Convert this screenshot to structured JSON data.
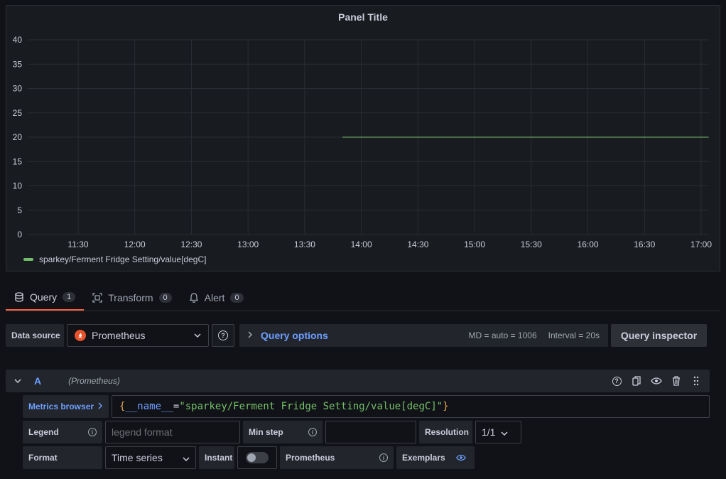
{
  "panel": {
    "title": "Panel Title"
  },
  "chart_data": {
    "type": "line",
    "title": "Panel Title",
    "y_ticks": [
      "40",
      "35",
      "30",
      "25",
      "20",
      "15",
      "10",
      "5",
      "0"
    ],
    "x_ticks": [
      "11:30",
      "12:00",
      "12:30",
      "13:00",
      "13:30",
      "14:00",
      "14:30",
      "15:00",
      "15:30",
      "16:00",
      "16:30",
      "17:00"
    ],
    "ylim": [
      0,
      40
    ],
    "grid": true,
    "legend_position": "bottom-left",
    "series": [
      {
        "name": "sparkey/Ferment Fridge Setting/value[degC]",
        "color": "#73bf69",
        "x": [
          "13:50",
          "17:04"
        ],
        "y": [
          20,
          20
        ]
      }
    ]
  },
  "tabs": [
    {
      "label": "Query",
      "count": "1",
      "icon": "database-icon"
    },
    {
      "label": "Transform",
      "count": "0",
      "icon": "transform-icon"
    },
    {
      "label": "Alert",
      "count": "0",
      "icon": "bell-icon"
    }
  ],
  "datasource": {
    "label": "Data source",
    "selected": "Prometheus",
    "query_options": "Query options",
    "md": "MD = auto = 1006",
    "interval": "Interval = 20s",
    "inspector": "Query inspector"
  },
  "query": {
    "ref": "A",
    "datasource_name": "(Prometheus)",
    "metrics_browser": "Metrics browser",
    "expr_brace_open": "{",
    "expr_label": "__name__",
    "expr_eq": "=",
    "expr_value": "\"sparkey/Ferment Fridge Setting/value[degC]\"",
    "expr_brace_close": "}",
    "legend_label": "Legend",
    "legend_placeholder": "legend format",
    "minstep_label": "Min step",
    "resolution_label": "Resolution",
    "resolution_value": "1/1",
    "format_label": "Format",
    "format_value": "Time series",
    "instant_label": "Instant",
    "prometheus_label": "Prometheus",
    "exemplars_label": "Exemplars"
  }
}
